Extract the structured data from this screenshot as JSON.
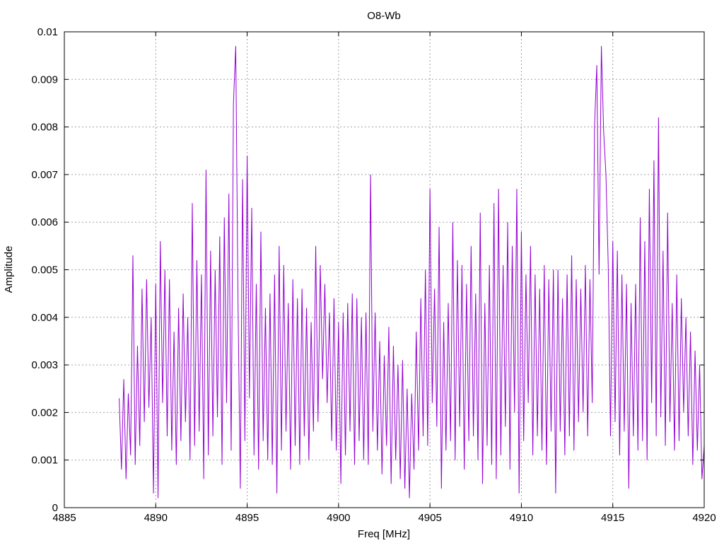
{
  "chart_data": {
    "type": "line",
    "title": "O8-Wb",
    "xlabel": "Freq [MHz]",
    "ylabel": "Amplitude",
    "xlim": [
      4885,
      4920
    ],
    "ylim": [
      0,
      0.01
    ],
    "xticks": [
      "4885",
      "4890",
      "4895",
      "4900",
      "4905",
      "4910",
      "4915",
      "4920"
    ],
    "yticks": [
      "0",
      "0.001",
      "0.002",
      "0.003",
      "0.004",
      "0.005",
      "0.006",
      "0.007",
      "0.008",
      "0.009",
      "0.01"
    ],
    "grid": true,
    "series_color": "#9400D3",
    "series": [
      {
        "name": "O8-Wb",
        "x_start": 4888,
        "x_step": 0.125,
        "values": [
          0.0023,
          0.0008,
          0.0027,
          0.0006,
          0.0024,
          0.0011,
          0.0053,
          0.0009,
          0.0034,
          0.0013,
          0.0046,
          0.0018,
          0.0048,
          0.0021,
          0.004,
          0.0003,
          0.0047,
          0.0002,
          0.0056,
          0.0022,
          0.005,
          0.0015,
          0.0048,
          0.0012,
          0.0037,
          0.0009,
          0.0042,
          0.0014,
          0.0045,
          0.0018,
          0.004,
          0.001,
          0.0064,
          0.0013,
          0.0052,
          0.0016,
          0.0049,
          0.0006,
          0.0071,
          0.0011,
          0.0054,
          0.0015,
          0.005,
          0.0019,
          0.0057,
          0.0009,
          0.0061,
          0.0022,
          0.0066,
          0.0012,
          0.0085,
          0.0097,
          0.0043,
          0.0004,
          0.0069,
          0.0014,
          0.0074,
          0.0023,
          0.0063,
          0.0011,
          0.0047,
          0.0008,
          0.0058,
          0.0014,
          0.0042,
          0.001,
          0.0045,
          0.0009,
          0.0049,
          0.0003,
          0.0055,
          0.0012,
          0.0051,
          0.0016,
          0.0043,
          0.0008,
          0.0048,
          0.0013,
          0.0044,
          0.0009,
          0.0046,
          0.0015,
          0.0042,
          0.001,
          0.0039,
          0.0016,
          0.0055,
          0.0018,
          0.0051,
          0.0027,
          0.0047,
          0.0022,
          0.0041,
          0.0014,
          0.0044,
          0.0012,
          0.0039,
          0.0005,
          0.0041,
          0.0011,
          0.0043,
          0.0016,
          0.0045,
          0.0009,
          0.0044,
          0.0014,
          0.004,
          0.001,
          0.0041,
          0.0009,
          0.007,
          0.0016,
          0.0041,
          0.0012,
          0.0035,
          0.0007,
          0.0032,
          0.0013,
          0.0038,
          0.0005,
          0.0034,
          0.001,
          0.003,
          0.0006,
          0.0031,
          0.0004,
          0.0025,
          0.0002,
          0.0024,
          0.0008,
          0.0037,
          0.0012,
          0.0044,
          0.0015,
          0.005,
          0.0013,
          0.0067,
          0.0022,
          0.0046,
          0.0017,
          0.0059,
          0.0004,
          0.0039,
          0.0012,
          0.0043,
          0.0014,
          0.006,
          0.001,
          0.0052,
          0.0017,
          0.0051,
          0.0008,
          0.0047,
          0.0014,
          0.0055,
          0.0015,
          0.0045,
          0.001,
          0.0062,
          0.0005,
          0.0043,
          0.0013,
          0.0051,
          0.0009,
          0.0064,
          0.0006,
          0.0067,
          0.0011,
          0.0051,
          0.0017,
          0.006,
          0.0008,
          0.0055,
          0.002,
          0.0067,
          0.0003,
          0.0058,
          0.0014,
          0.0049,
          0.0022,
          0.0055,
          0.0011,
          0.0049,
          0.0015,
          0.0046,
          0.0012,
          0.0051,
          0.0009,
          0.0048,
          0.0016,
          0.005,
          0.0003,
          0.005,
          0.0016,
          0.0044,
          0.0011,
          0.0049,
          0.0015,
          0.0053,
          0.0012,
          0.0048,
          0.0018,
          0.0046,
          0.002,
          0.0051,
          0.0015,
          0.0048,
          0.0022,
          0.008,
          0.0093,
          0.0049,
          0.0097,
          0.0079,
          0.007,
          0.0051,
          0.0015,
          0.0056,
          0.0018,
          0.0054,
          0.0011,
          0.0049,
          0.0016,
          0.0047,
          0.0004,
          0.0043,
          0.0015,
          0.0047,
          0.0012,
          0.0061,
          0.0014,
          0.0056,
          0.001,
          0.0067,
          0.0022,
          0.0073,
          0.0015,
          0.0082,
          0.0019,
          0.0054,
          0.0013,
          0.0062,
          0.0018,
          0.0043,
          0.0012,
          0.0049,
          0.0014,
          0.0044,
          0.002,
          0.004,
          0.0015,
          0.0037,
          0.0009,
          0.0033,
          0.0012,
          0.003,
          0.0006,
          0.0013
        ]
      }
    ]
  }
}
